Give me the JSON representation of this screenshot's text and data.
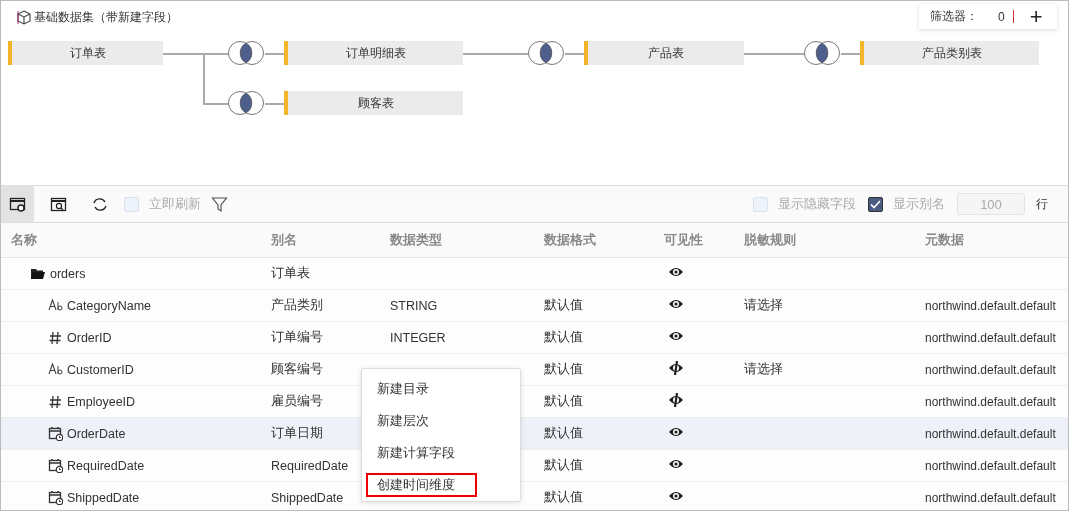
{
  "title": "基础数据集（带新建字段）",
  "filter": {
    "label": "筛选器：",
    "count": "0",
    "add": "+"
  },
  "diagram": {
    "tables": [
      {
        "name": "订单表",
        "children": [
          {
            "name": "订单明细表",
            "children": [
              {
                "name": "产品表",
                "children": [
                  {
                    "name": "产品类别表"
                  }
                ]
              }
            ]
          },
          {
            "name": "顾客表"
          }
        ]
      }
    ]
  },
  "toolbar": {
    "buttons": [
      {
        "kind": "settings",
        "selected": true
      },
      {
        "kind": "preview",
        "selected": false
      },
      {
        "kind": "refresh",
        "selected": false
      }
    ],
    "auto_refresh": {
      "label": "立即刷新",
      "checked": false,
      "disabled": true
    },
    "show_hidden": {
      "label": "显示隐藏字段",
      "checked": false
    },
    "show_alias": {
      "label": "显示别名",
      "checked": true
    },
    "row_limit": {
      "value": "100",
      "unit": "行"
    }
  },
  "table": {
    "columns": [
      "名称",
      "别名",
      "数据类型",
      "数据格式",
      "可见性",
      "脱敏规则",
      "元数据"
    ],
    "rows": [
      {
        "kind": "folder",
        "name": "orders",
        "alias": "订单表",
        "visible": true,
        "selected": false,
        "children": [
          {
            "kind": "string",
            "name": "CategoryName",
            "alias": "产品类别",
            "type": "STRING",
            "format": "默认值",
            "visible": true,
            "masking": "请选择",
            "metadata": "northwind.default.default",
            "selected": false
          },
          {
            "kind": "number",
            "name": "OrderID",
            "alias": "订单编号",
            "type": "INTEGER",
            "format": "默认值",
            "visible": true,
            "metadata": "northwind.default.default",
            "selected": false
          },
          {
            "kind": "string",
            "name": "CustomerID",
            "alias": "顾客编号",
            "format": "默认值",
            "visible": false,
            "masking": "请选择",
            "metadata": "northwind.default.default",
            "selected": false
          },
          {
            "kind": "number",
            "name": "EmployeeID",
            "alias": "雇员编号",
            "format": "默认值",
            "visible": false,
            "metadata": "northwind.default.default",
            "selected": false
          },
          {
            "kind": "date",
            "name": "OrderDate",
            "alias": "订单日期",
            "format": "默认值",
            "visible": true,
            "metadata": "northwind.default.default",
            "selected": true
          },
          {
            "kind": "date",
            "name": "RequiredDate",
            "alias": "RequiredDate",
            "format": "默认值",
            "visible": true,
            "metadata": "northwind.default.default",
            "selected": false
          },
          {
            "kind": "date",
            "name": "ShippedDate",
            "alias": "ShippedDate",
            "format": "默认值",
            "visible": true,
            "metadata": "northwind.default.default",
            "selected": false
          }
        ]
      }
    ]
  },
  "context_menu": {
    "items": [
      {
        "label": "新建目录",
        "selected": false
      },
      {
        "label": "新建层次",
        "selected": false
      },
      {
        "label": "新建计算字段",
        "selected": false
      },
      {
        "label": "创建时间维度",
        "selected": true
      }
    ]
  }
}
